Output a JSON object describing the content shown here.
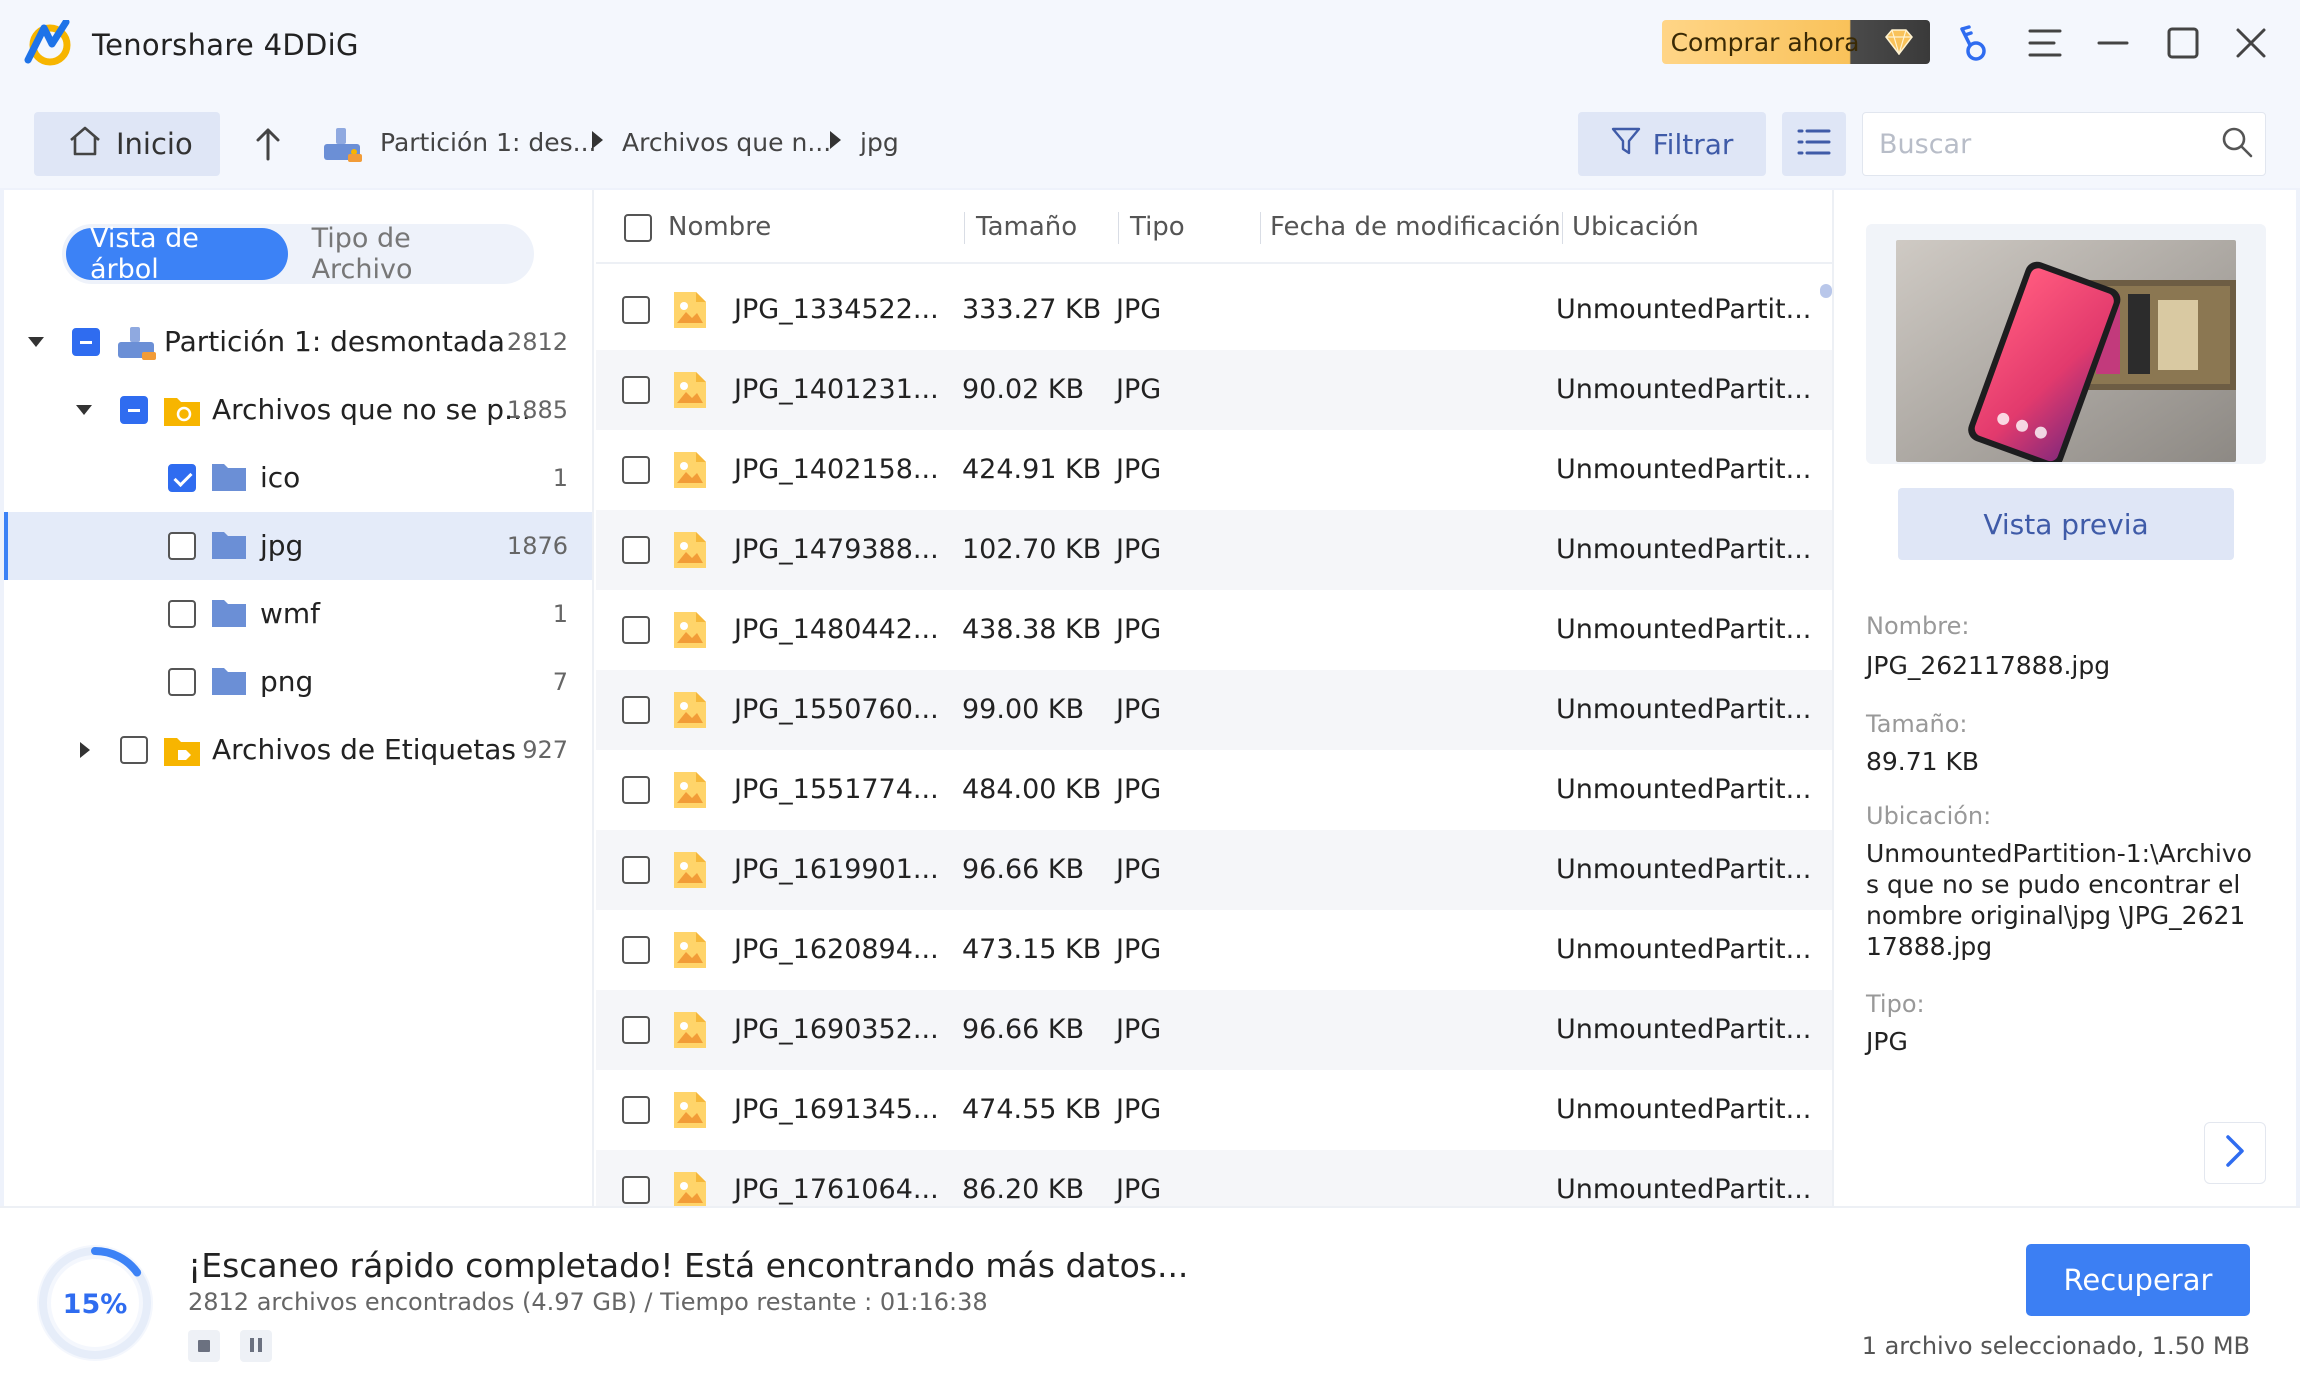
{
  "app": {
    "title": "Tenorshare 4DDiG",
    "buy_label": "Comprar ahora"
  },
  "toolbar": {
    "home_label": "Inicio",
    "breadcrumbs": [
      "Partición 1: des...",
      "Archivos que n...",
      "jpg"
    ],
    "filter_label": "Filtrar",
    "search_placeholder": "Buscar"
  },
  "sidebar": {
    "tabs": {
      "tree": "Vista de árbol",
      "filetype": "Tipo de Archivo"
    },
    "tree": [
      {
        "label": "Partición 1: desmontada",
        "count": "2812",
        "state": "partial",
        "expanded": true
      },
      {
        "label": "Archivos que no se p...",
        "count": "1885",
        "state": "partial",
        "expanded": true
      },
      {
        "label": "ico",
        "count": "1",
        "state": "checked"
      },
      {
        "label": "jpg",
        "count": "1876",
        "state": "unchecked",
        "selected": true
      },
      {
        "label": "wmf",
        "count": "1",
        "state": "unchecked"
      },
      {
        "label": "png",
        "count": "7",
        "state": "unchecked"
      },
      {
        "label": "Archivos de Etiquetas",
        "count": "927",
        "state": "unchecked",
        "expanded": false
      }
    ]
  },
  "table": {
    "columns": [
      "Nombre",
      "Tamaño",
      "Tipo",
      "Fecha de modificación",
      "Ubicación"
    ],
    "rows": [
      {
        "name": "JPG_1334522...",
        "size": "333.27 KB",
        "type": "JPG",
        "location": "UnmountedPartit..."
      },
      {
        "name": "JPG_1401231...",
        "size": "90.02 KB",
        "type": "JPG",
        "location": "UnmountedPartit..."
      },
      {
        "name": "JPG_1402158...",
        "size": "424.91 KB",
        "type": "JPG",
        "location": "UnmountedPartit..."
      },
      {
        "name": "JPG_1479388...",
        "size": "102.70 KB",
        "type": "JPG",
        "location": "UnmountedPartit..."
      },
      {
        "name": "JPG_1480442...",
        "size": "438.38 KB",
        "type": "JPG",
        "location": "UnmountedPartit..."
      },
      {
        "name": "JPG_1550760...",
        "size": "99.00 KB",
        "type": "JPG",
        "location": "UnmountedPartit..."
      },
      {
        "name": "JPG_1551774...",
        "size": "484.00 KB",
        "type": "JPG",
        "location": "UnmountedPartit..."
      },
      {
        "name": "JPG_1619901...",
        "size": "96.66 KB",
        "type": "JPG",
        "location": "UnmountedPartit..."
      },
      {
        "name": "JPG_1620894...",
        "size": "473.15 KB",
        "type": "JPG",
        "location": "UnmountedPartit..."
      },
      {
        "name": "JPG_1690352...",
        "size": "96.66 KB",
        "type": "JPG",
        "location": "UnmountedPartit..."
      },
      {
        "name": "JPG_1691345...",
        "size": "474.55 KB",
        "type": "JPG",
        "location": "UnmountedPartit..."
      },
      {
        "name": "JPG_1761064...",
        "size": "86.20 KB",
        "type": "JPG",
        "location": "UnmountedPartit..."
      }
    ]
  },
  "details": {
    "preview_label": "Vista previa",
    "name_label": "Nombre:",
    "name_value": "JPG_262117888.jpg",
    "size_label": "Tamaño:",
    "size_value": "89.71 KB",
    "location_label": "Ubicación:",
    "location_value": "UnmountedPartition-1:\\Archivos que no se pudo encontrar el nombre original\\jpg \\JPG_262117888.jpg",
    "type_label": "Tipo:",
    "type_value": "JPG"
  },
  "footer": {
    "progress_text": "15%",
    "progress_value": 0.15,
    "status_title": "¡Escaneo rápido completado! Está encontrando más datos...",
    "status_sub": "2812 archivos encontrados (4.97 GB) /  Tiempo restante : 01:16:38",
    "recover_label": "Recuperar",
    "selection_info": "1 archivo seleccionado, 1.50 MB"
  },
  "colors": {
    "accent": "#3c82f6",
    "buy_gold": "#f9c25a",
    "selected_row": "#e4ebf9"
  }
}
